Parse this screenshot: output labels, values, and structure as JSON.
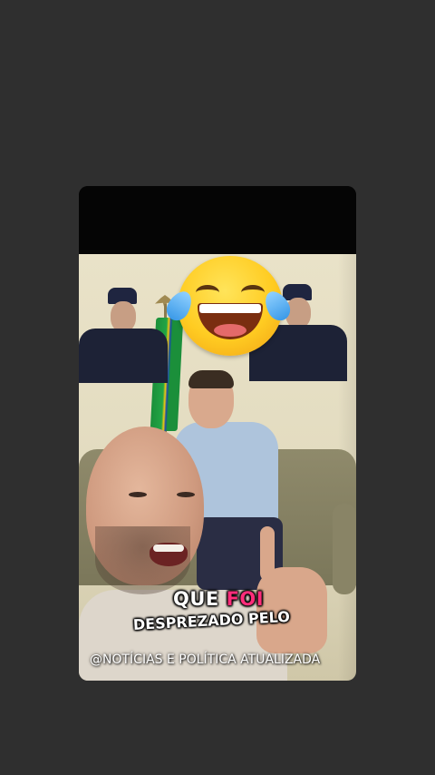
{
  "story": {
    "caption": {
      "word1": "QUE ",
      "word2_highlight": "FOI",
      "line2": "DESPREZADO PELO"
    },
    "watermark": "@NOTÍCIAS E POLÍTICA ATUALIZADA",
    "emoji": "face-with-tears-of-joy",
    "colors": {
      "background": "#2f2f2f",
      "caption_text": "#ffffff",
      "caption_highlight": "#ff2d7a"
    }
  }
}
